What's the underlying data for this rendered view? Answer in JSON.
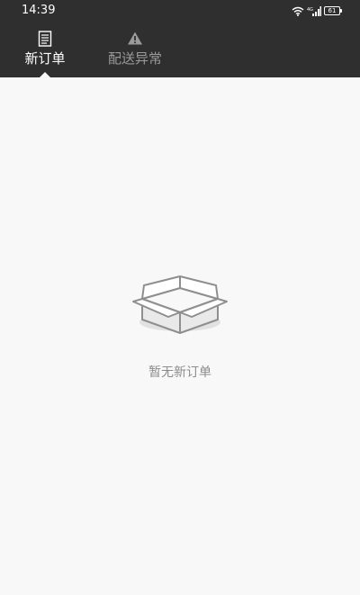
{
  "status_bar": {
    "time": "14:39",
    "battery": "61",
    "icons": [
      "wifi-icon",
      "signal-icon",
      "battery-icon"
    ]
  },
  "tabs": [
    {
      "label": "新订单",
      "icon": "document-icon",
      "selected": true
    },
    {
      "label": "配送异常",
      "icon": "warning-icon",
      "selected": false
    }
  ],
  "empty_state": {
    "icon": "empty-box-icon",
    "text": "暂无新订单"
  },
  "colors": {
    "header_bg": "#2f2f2f",
    "page_bg": "#f8f8f8",
    "active_tab": "#ffffff",
    "inactive_tab": "#9a9a9a",
    "empty_text": "#8c8c8c"
  }
}
